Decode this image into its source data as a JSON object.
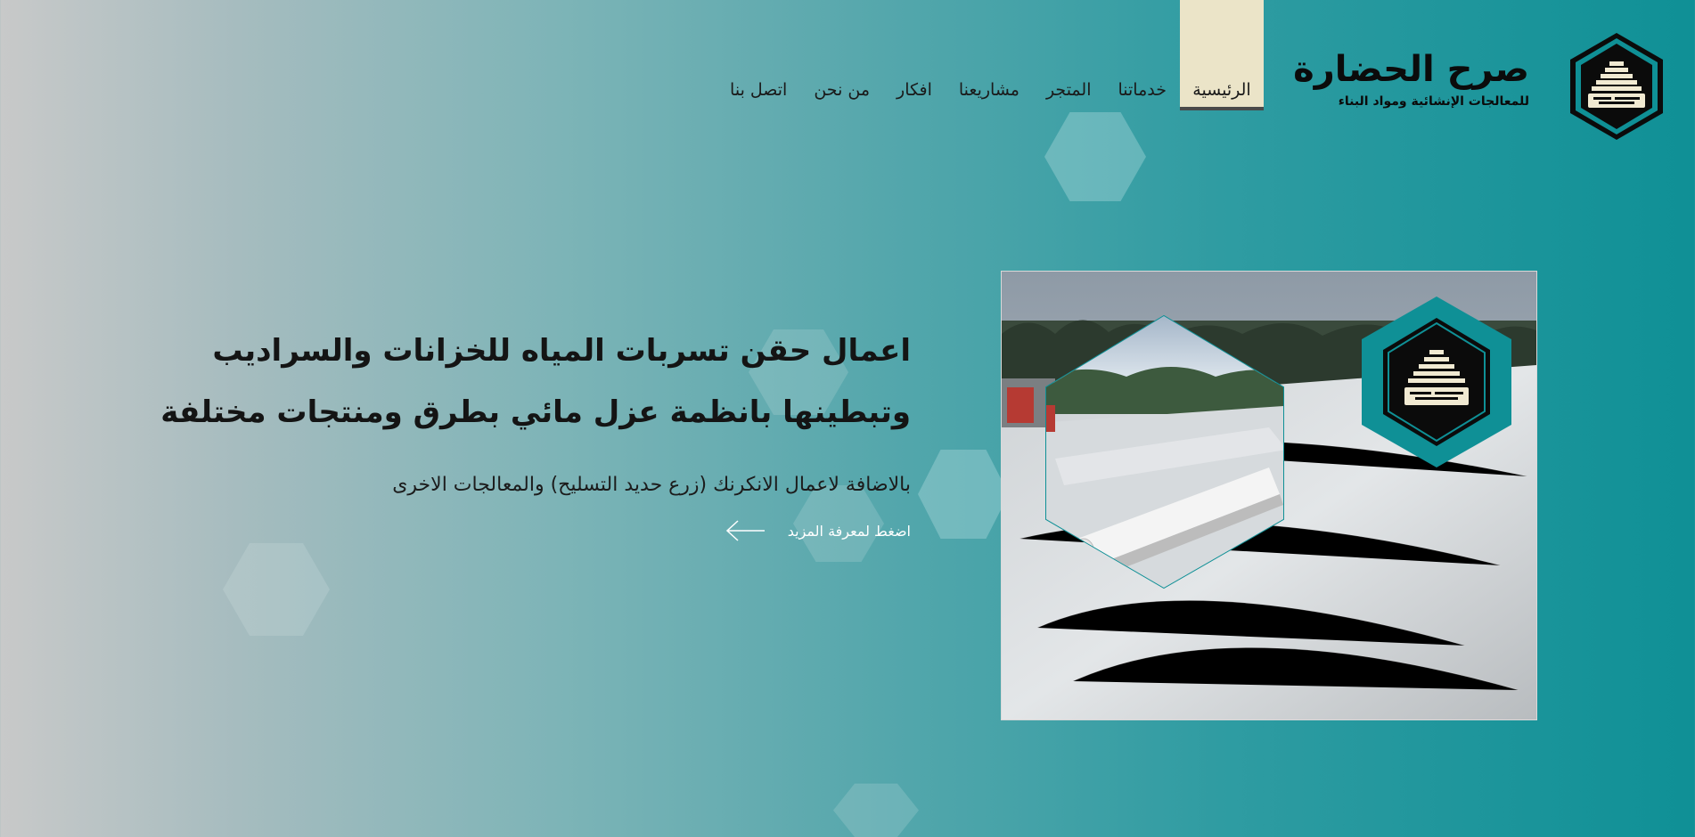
{
  "brand": {
    "name": "صرح الحضارة",
    "tagline": "للمعالجات الإنشائية ومواد البناء"
  },
  "nav": {
    "items": [
      "الرئيسية",
      "خدماتنا",
      "المتجر",
      "مشاريعنا",
      "افكار",
      "من نحن",
      "اتصل بنا"
    ],
    "active": "الرئيسية"
  },
  "hero": {
    "line1": "اعمال حقن تسربات المياه للخزانات والسراديب",
    "line2": "وتبطينها بانظمة عزل مائي بطرق ومنتجات مختلفة",
    "subtitle": "بالاضافة لاعمال الانكرنك (زرع حديد التسليح) والمعالجات الاخرى",
    "cta": "اضغط لمعرفة المزيد"
  },
  "colors": {
    "accent": "#0f9096",
    "nav_active_bg": "#ebe4c8",
    "logo_dark": "#0b0b0b",
    "logo_cream": "#f1ead2"
  },
  "icons": [
    "logo-mark-icon",
    "arrow-left-icon",
    "hex-watermark-icon"
  ]
}
